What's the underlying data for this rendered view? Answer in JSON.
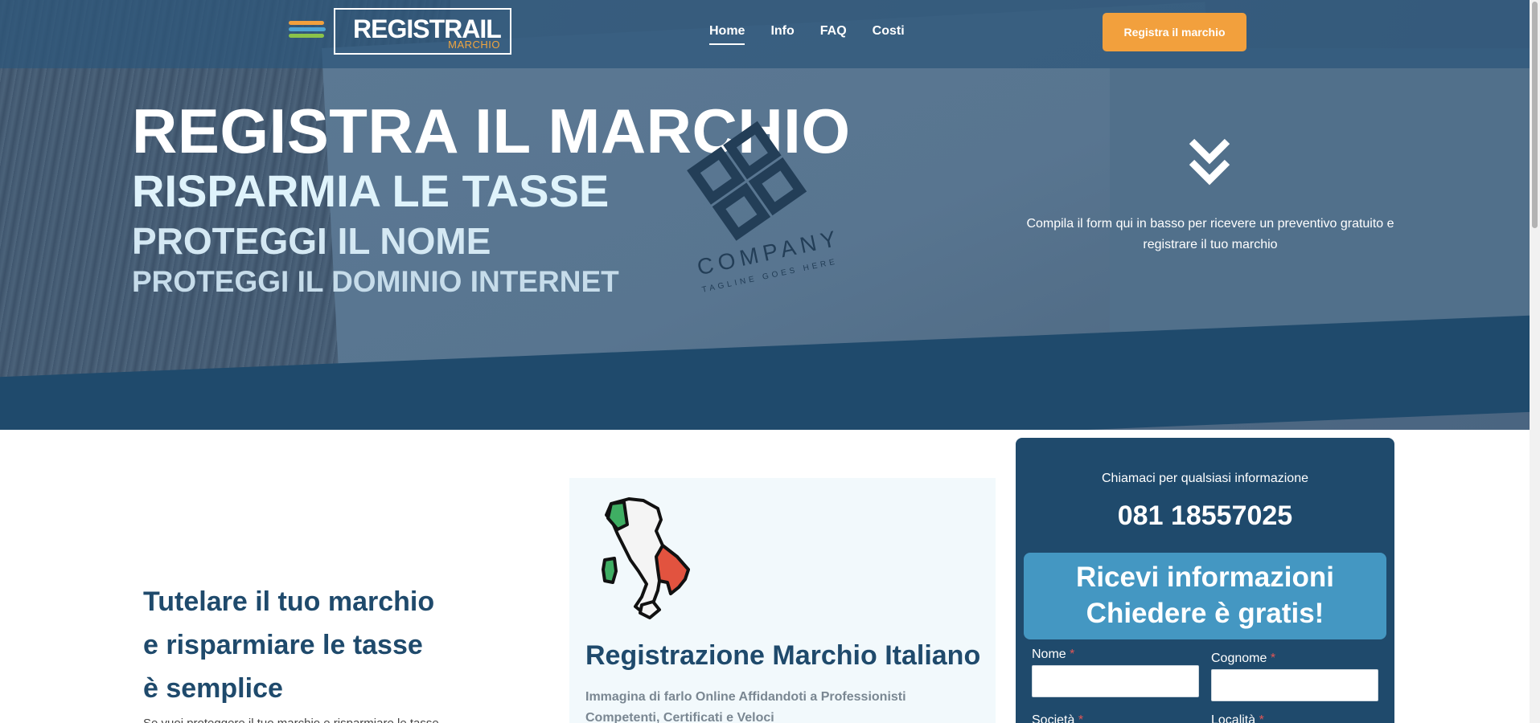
{
  "nav": {
    "logo_main": "REGISTRAIL",
    "logo_sub": "MARCHIO",
    "stripe_colors": [
      "#f2a03d",
      "#4fa3d1",
      "#8bc34a"
    ],
    "items": [
      {
        "label": "Home",
        "active": true
      },
      {
        "label": "Info",
        "active": false
      },
      {
        "label": "FAQ",
        "active": false
      },
      {
        "label": "Costi",
        "active": false
      }
    ],
    "cta_label": "Registra il marchio"
  },
  "hero": {
    "line1": "REGISTRA IL MARCHIO",
    "line2": "RISPARMIA LE TASSE",
    "line3": "PROTEGGI IL NOME",
    "line4": "PROTEGGI IL DOMINIO INTERNET",
    "company_text": "COMPANY",
    "company_tagline": "TAGLINE GOES HERE",
    "scroll_icon": "double-chevron-down-icon",
    "note": "Compila il form qui in basso per ricevere un preventivo gratuito e registrare il tuo marchio"
  },
  "intro": {
    "title_lines": [
      "Tutelare il tuo marchio",
      "e risparmiare le tasse",
      "è semplice"
    ],
    "cut_text": "Se vuoi proteggere il tuo marchio e risparmiare le tasse"
  },
  "card": {
    "icon": "italy-map-icon",
    "title": "Registrazione Marchio Italiano",
    "text": "Immagina di farlo Online Affidandoti a Professionisti Competenti, Certificati e Veloci"
  },
  "form_panel": {
    "call_text": "Chiamaci per qualsiasi informazione",
    "phone": "081 18557025",
    "box_line1": "Ricevi informazioni",
    "box_line2": "Chiedere è gratis!",
    "fields": {
      "nome": "Nome",
      "cognome": "Cognome",
      "societa": "Società",
      "localita": "Località"
    },
    "required_mark": "*"
  },
  "colors": {
    "brand_dark": "#1f4a6c",
    "accent_orange": "#f2a03d",
    "accent_blue": "#4497c2",
    "card_bg": "#f2f9fc"
  }
}
